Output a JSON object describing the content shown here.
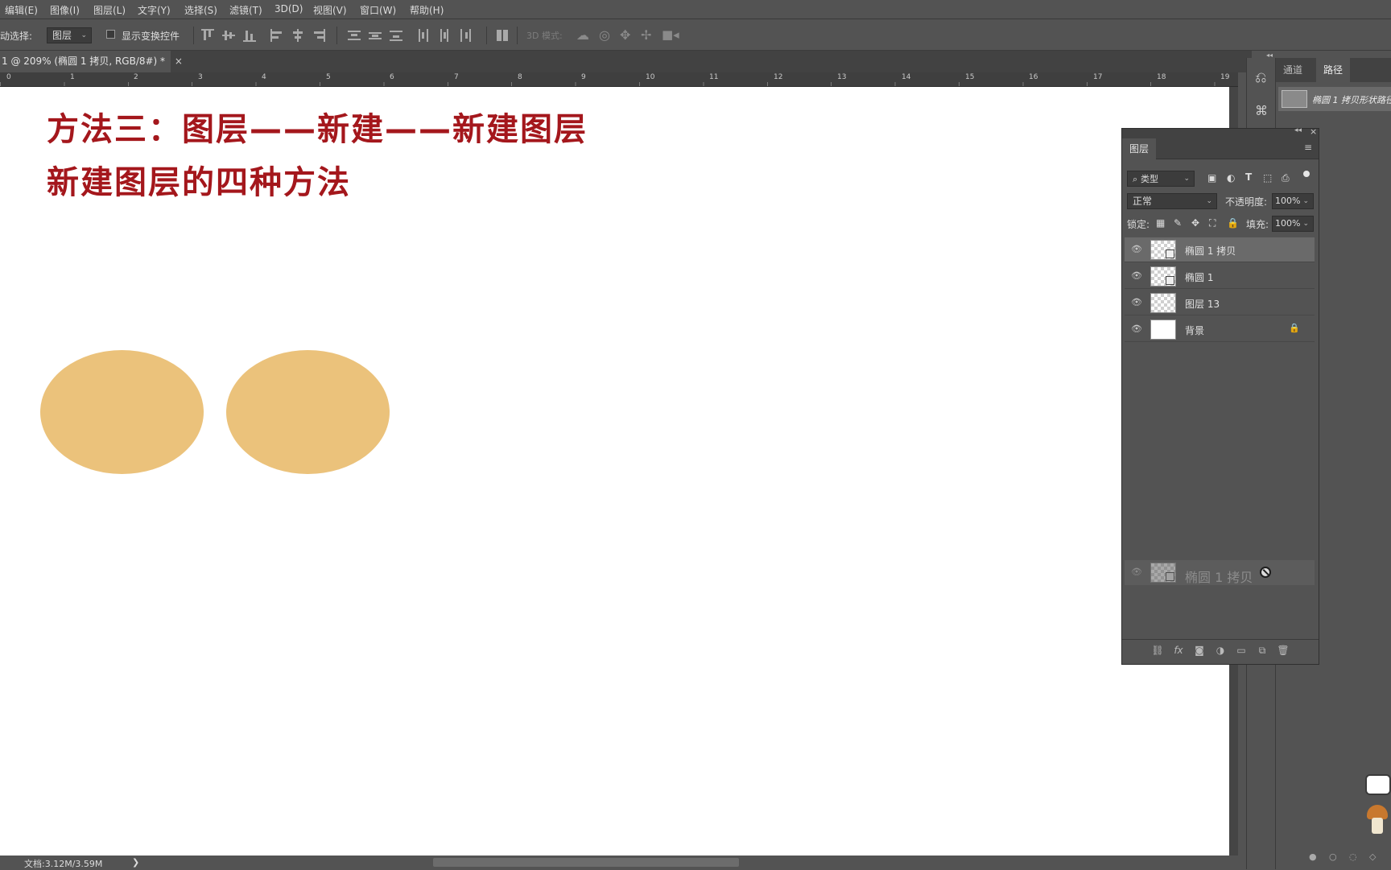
{
  "menu": [
    "编辑(E)",
    "图像(I)",
    "图层(L)",
    "文字(Y)",
    "选择(S)",
    "滤镜(T)",
    "3D(D)",
    "视图(V)",
    "窗口(W)",
    "帮助(H)"
  ],
  "options": {
    "auto_select_label": "动选择:",
    "auto_select_value": "图层",
    "show_transform_label": "显示变换控件",
    "mode_3d_label": "3D 模式:"
  },
  "doc_tab": {
    "title": "1 @ 209% (椭圆 1 拷贝, RGB/8#) *",
    "close": "×"
  },
  "ruler_numbers": [
    "0",
    "1",
    "2",
    "3",
    "4",
    "5",
    "6",
    "7",
    "8",
    "9",
    "10",
    "11",
    "12",
    "13",
    "14",
    "15",
    "16",
    "17",
    "18",
    "19"
  ],
  "canvas": {
    "line1": "方法三：图层——新建——新建图层",
    "line2": "新建图层的四种方法",
    "ellipse_color": "#ebc27b",
    "text_color": "#a4171c"
  },
  "status": {
    "doc_size": "文档:3.12M/3.59M",
    "arrow": "❯"
  },
  "right_panel": {
    "tabs": [
      "通道",
      "路径"
    ],
    "path_item": "椭圆 1 拷贝形状路径"
  },
  "layers_panel": {
    "title": "图层",
    "filter_type": "类型",
    "blend_mode": "正常",
    "opacity_label": "不透明度:",
    "opacity_value": "100%",
    "lock_label": "锁定:",
    "fill_label": "填充:",
    "fill_value": "100%",
    "layers": [
      {
        "name": "椭圆 1 拷贝",
        "selected": true,
        "smart": true,
        "white": false
      },
      {
        "name": "椭圆 1",
        "selected": false,
        "smart": true,
        "white": false
      },
      {
        "name": "图层 13",
        "selected": false,
        "smart": false,
        "white": false
      },
      {
        "name": "背景",
        "selected": false,
        "smart": false,
        "white": true,
        "locked": true
      }
    ],
    "drag_ghost": "椭圆 1 拷贝"
  }
}
